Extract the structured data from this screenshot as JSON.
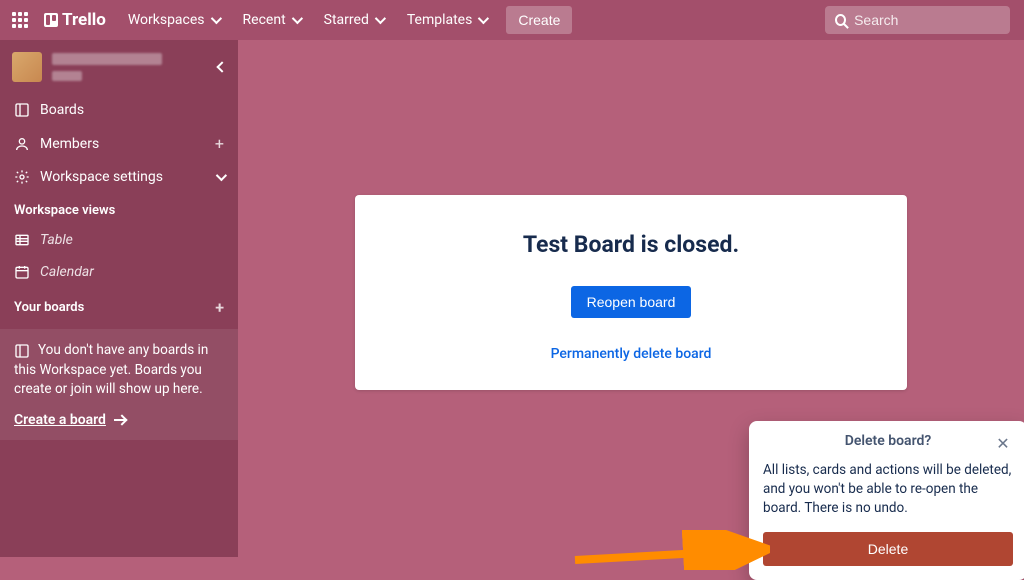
{
  "topbar": {
    "logo_text": "Trello",
    "nav": {
      "workspaces": "Workspaces",
      "recent": "Recent",
      "starred": "Starred",
      "templates": "Templates"
    },
    "create": "Create",
    "search_placeholder": "Search"
  },
  "sidebar": {
    "items": {
      "boards": "Boards",
      "members": "Members",
      "settings": "Workspace settings"
    },
    "views_header": "Workspace views",
    "views": {
      "table": "Table",
      "calendar": "Calendar"
    },
    "your_boards_header": "Your boards",
    "no_boards_message": "You don't have any boards in this Workspace yet. Boards you create or join will show up here.",
    "create_board_link": "Create a board"
  },
  "closed_panel": {
    "title": "Test Board is closed.",
    "reopen_button": "Reopen board",
    "delete_link": "Permanently delete board"
  },
  "popover": {
    "title": "Delete board?",
    "body": "All lists, cards and actions will be deleted, and you won't be able to re-open the board. There is no undo.",
    "delete_button": "Delete"
  }
}
